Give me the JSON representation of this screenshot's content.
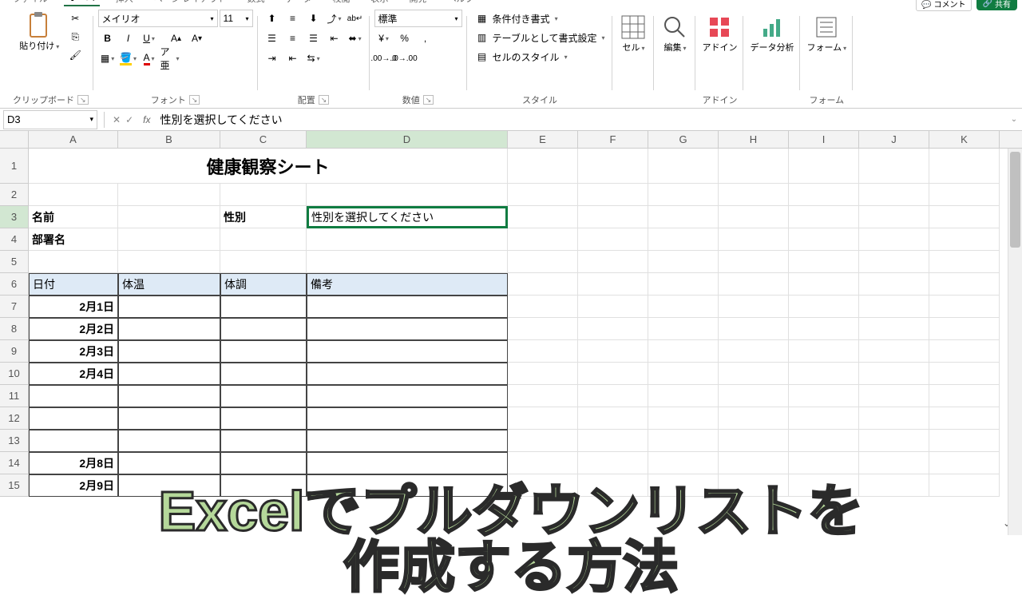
{
  "tabs": {
    "file": "ファイル",
    "home": "ホーム",
    "insert": "挿入",
    "layout": "ページ レイアウト",
    "formula": "数式",
    "data": "データ",
    "review": "校閲",
    "view": "表示",
    "dev": "開発",
    "help": "ヘルプ"
  },
  "top_buttons": {
    "comment": "コメント",
    "share": "共有"
  },
  "clipboard": {
    "paste": "貼り付け",
    "label": "クリップボード"
  },
  "font": {
    "name": "メイリオ",
    "size": "11",
    "label": "フォント"
  },
  "align": {
    "label": "配置"
  },
  "number": {
    "format": "標準",
    "label": "数値"
  },
  "style": {
    "cond": "条件付き書式",
    "table": "テーブルとして書式設定",
    "cell": "セルのスタイル",
    "label": "スタイル"
  },
  "groups": {
    "cell": "セル",
    "edit": "編集",
    "addin": "アドイン",
    "analysis": "データ分析",
    "form": "フォーム",
    "addin_label": "アドイン",
    "form_label": "フォーム"
  },
  "namebox": "D3",
  "formula": "性別を選択してください",
  "columns": [
    "A",
    "B",
    "C",
    "D",
    "E",
    "F",
    "G",
    "H",
    "I",
    "J",
    "K"
  ],
  "rows": [
    "1",
    "2",
    "3",
    "4",
    "5",
    "6",
    "7",
    "8",
    "9",
    "10",
    "11",
    "12",
    "13",
    "14",
    "15"
  ],
  "sheet": {
    "title": "健康観察シート",
    "r3": {
      "a": "名前",
      "c": "性別",
      "d": "性別を選択してください"
    },
    "r4": {
      "a": "部署名"
    },
    "r6": {
      "a": "日付",
      "b": "体温",
      "c": "体調",
      "d": "備考"
    },
    "dates": [
      "2月1日",
      "2月2日",
      "2月3日",
      "2月4日",
      "",
      "",
      "",
      "2月8日",
      "2月9日"
    ]
  },
  "overlay": {
    "line1": "Excelでプルダウンリストを",
    "line2": "作成する方法"
  }
}
